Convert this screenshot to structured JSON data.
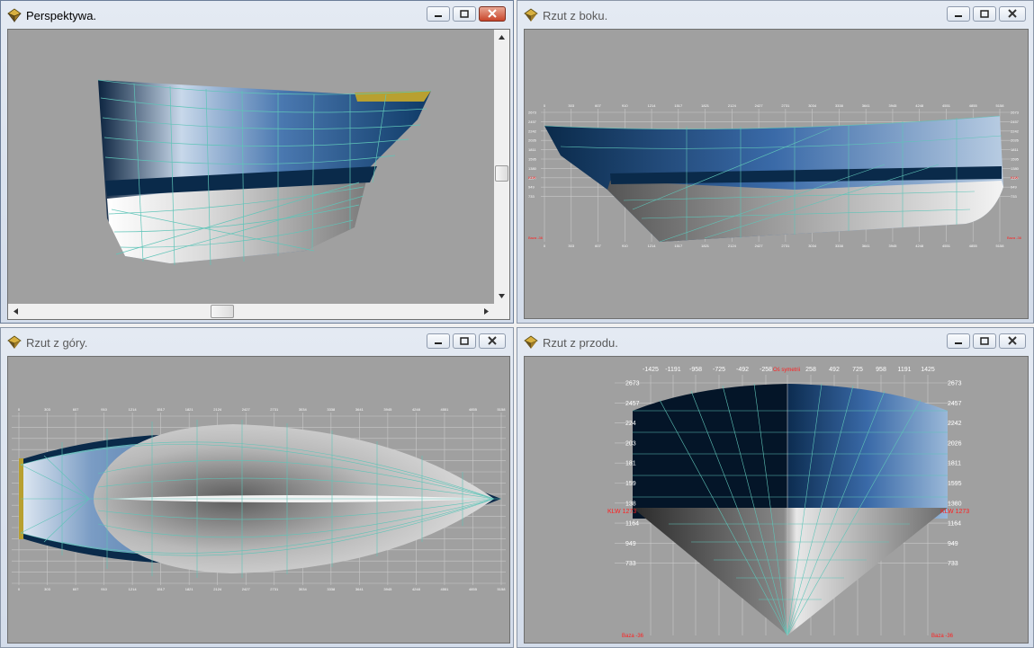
{
  "colors": {
    "viewport_bg": "#a0a0a0",
    "mesh_line": "#5fc4b8",
    "hull_dark": "#0a2a4a",
    "hull_blue": "#5a8ac0",
    "hull_light": "#f2f2f2",
    "deck_gold": "#b8a030",
    "label_red": "#ff2020"
  },
  "windows": {
    "perspective": {
      "title": "Perspektywa.",
      "active": true,
      "controls": [
        "minimize-icon",
        "restore-icon",
        "close-icon"
      ]
    },
    "side": {
      "title": "Rzut z boku.",
      "controls": [
        "minimize-icon",
        "restore-icon",
        "close-icon"
      ],
      "x_ticks": [
        "0",
        "303",
        "607",
        "910",
        "1214",
        "1517",
        "1821",
        "2124",
        "2427",
        "2731",
        "3034",
        "3338",
        "3641",
        "3945",
        "4248",
        "4551",
        "4855",
        "5158"
      ],
      "y_ticks": [
        "2673",
        "2457",
        "2242",
        "2026",
        "1811",
        "1595",
        "1380",
        "1164",
        "949",
        "733"
      ],
      "klw_label": "KLW",
      "base_label": "Baza -36"
    },
    "top": {
      "title": "Rzut z góry.",
      "controls": [
        "minimize-icon",
        "restore-icon",
        "close-icon"
      ],
      "x_ticks": [
        "0",
        "303",
        "607",
        "910",
        "1214",
        "1517",
        "1821",
        "2124",
        "2427",
        "2731",
        "3034",
        "3338",
        "3641",
        "3945",
        "4248",
        "4551",
        "4855",
        "5158"
      ]
    },
    "front": {
      "title": "Rzut z przodu.",
      "controls": [
        "minimize-icon",
        "restore-icon",
        "close-icon"
      ],
      "top_ticks_left": [
        "-1425",
        "-1191",
        "-958",
        "-725",
        "-492",
        "-258"
      ],
      "symmetry_label": "Oś symetrii",
      "top_ticks_right": [
        "258",
        "492",
        "725",
        "958",
        "1191",
        "1425"
      ],
      "y_ticks_right": [
        "2673",
        "2457",
        "2242",
        "2026",
        "1811",
        "1595",
        "1380",
        "1164",
        "949",
        "733"
      ],
      "y_ticks_left": [
        "2673",
        "2457",
        "224",
        "203",
        "181",
        "159",
        "138",
        "1164",
        "949",
        "733"
      ],
      "klw_left": "KLW 1273",
      "klw_right": "KLW 1273",
      "base_left": "Baza -36",
      "base_right": "Baza -36"
    }
  }
}
